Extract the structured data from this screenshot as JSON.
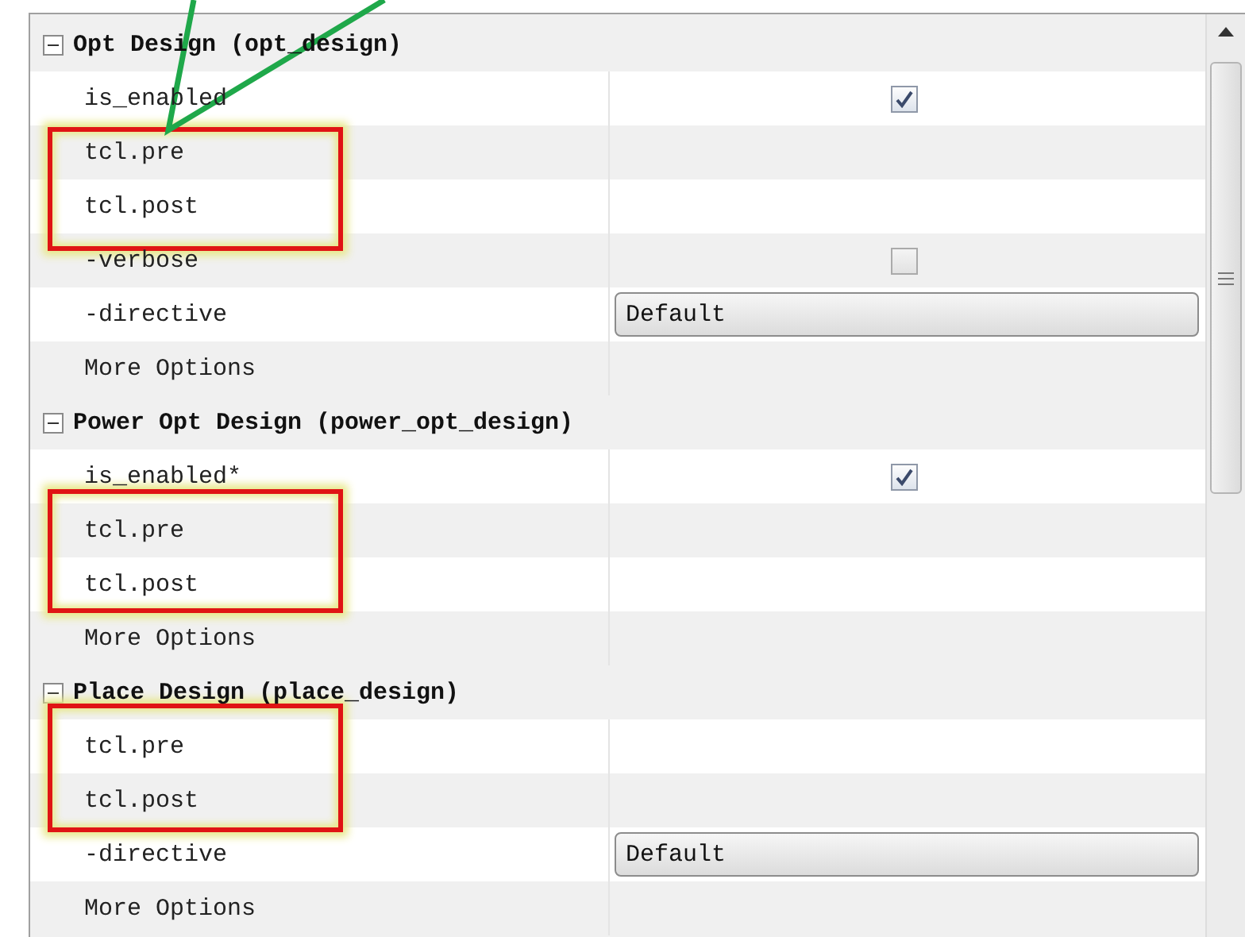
{
  "sections": [
    {
      "title": "Opt Design (opt_design)",
      "expanded": true,
      "rows": [
        {
          "label": "is_enabled",
          "kind": "checkbox",
          "checked": true
        },
        {
          "label": "tcl.pre",
          "kind": "text"
        },
        {
          "label": "tcl.post",
          "kind": "text"
        },
        {
          "label": "-verbose",
          "kind": "checkbox",
          "checked": false
        },
        {
          "label": "-directive",
          "kind": "dropdown",
          "value": "Default"
        },
        {
          "label": "More Options",
          "kind": "text"
        }
      ]
    },
    {
      "title": "Power Opt Design (power_opt_design)",
      "expanded": true,
      "rows": [
        {
          "label": "is_enabled*",
          "kind": "checkbox",
          "checked": true
        },
        {
          "label": "tcl.pre",
          "kind": "text"
        },
        {
          "label": "tcl.post",
          "kind": "text"
        },
        {
          "label": "More Options",
          "kind": "text"
        }
      ]
    },
    {
      "title": "Place Design (place_design)",
      "expanded": true,
      "rows": [
        {
          "label": "tcl.pre",
          "kind": "text"
        },
        {
          "label": "tcl.post",
          "kind": "text"
        },
        {
          "label": "-directive",
          "kind": "dropdown",
          "value": "Default"
        },
        {
          "label": "More Options",
          "kind": "text"
        }
      ]
    }
  ]
}
